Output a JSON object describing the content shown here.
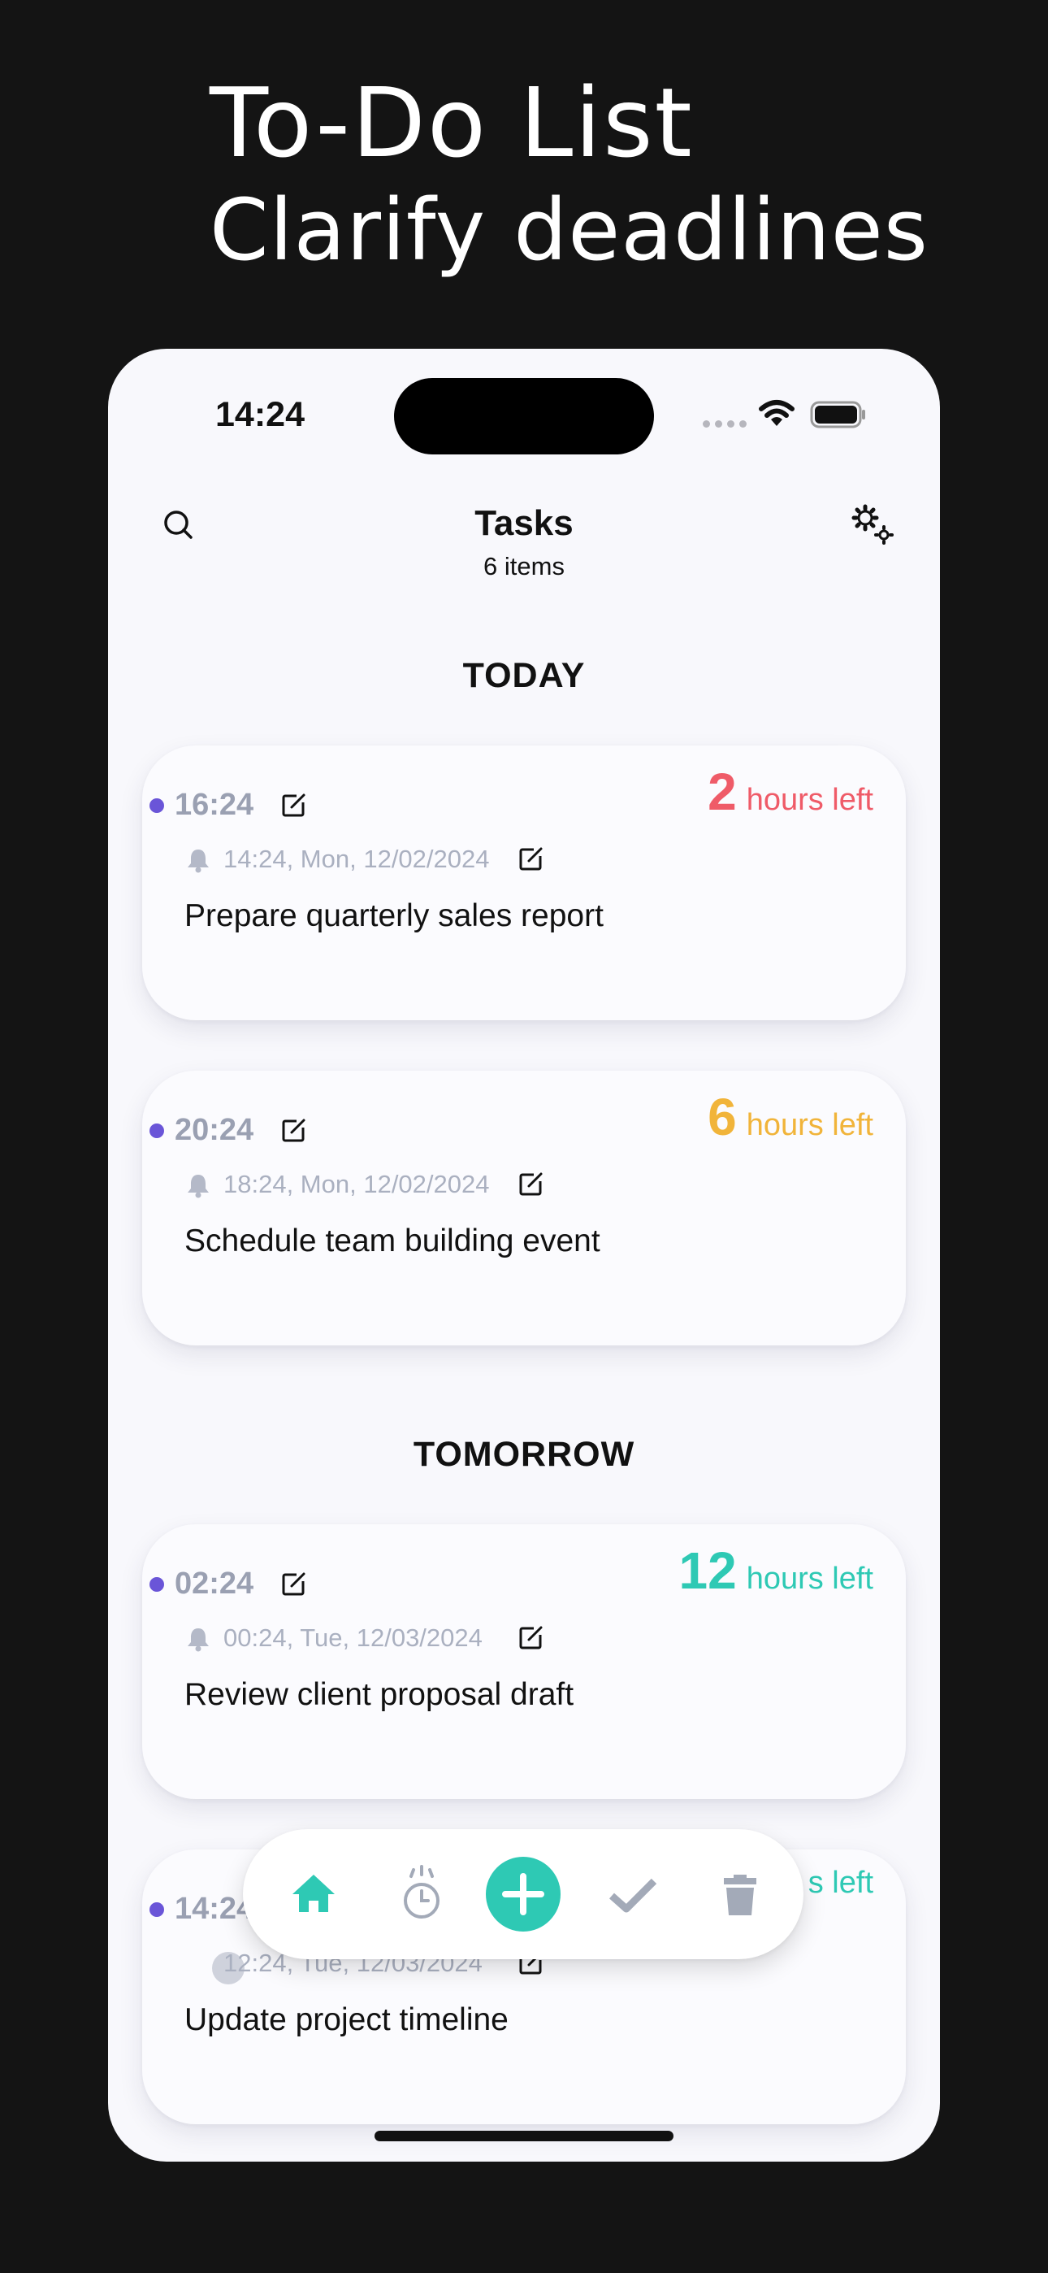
{
  "promo": {
    "line1": "To-Do List",
    "line2": "Clarify deadlines"
  },
  "status_bar": {
    "time": "14:24"
  },
  "header": {
    "title": "Tasks",
    "subtitle": "6 items"
  },
  "sections": {
    "today": "TODAY",
    "tomorrow": "TOMORROW"
  },
  "tasks": [
    {
      "time": "16:24",
      "reminder": "14:24, Mon, 12/02/2024",
      "title": "Prepare quarterly sales report",
      "left_number": "2",
      "left_text": "hours left",
      "color": "#ef5b68"
    },
    {
      "time": "20:24",
      "reminder": "18:24, Mon, 12/02/2024",
      "title": "Schedule team building event",
      "left_number": "6",
      "left_text": "hours left",
      "color": "#f1b43a"
    },
    {
      "time": "02:24",
      "reminder": "00:24, Tue, 12/03/2024",
      "title": "Review client proposal draft",
      "left_number": "12",
      "left_text": "hours left",
      "color": "#2ec9b4"
    },
    {
      "time": "14:24",
      "reminder": "12:24, Tue, 12/03/2024",
      "title": "Update project timeline",
      "left_text": "s left",
      "color": "#2ec9b4"
    }
  ],
  "tab_bar": {
    "items": [
      "home-icon",
      "timer-icon",
      "add-icon",
      "check-icon",
      "trash-icon"
    ],
    "accent": "#2ec9b4",
    "inactive": "#a3aab8"
  }
}
